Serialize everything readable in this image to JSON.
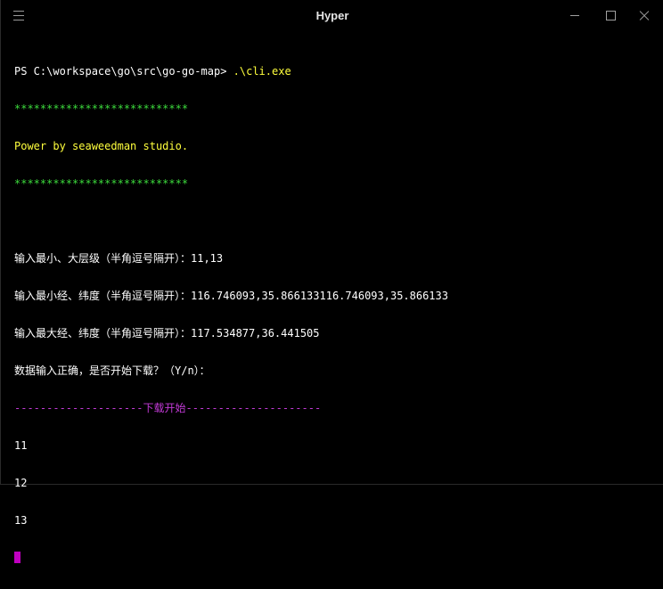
{
  "window": {
    "title": "Hyper",
    "menu_icon": "hamburger-menu-icon",
    "controls": {
      "minimize_icon": "minimize-icon",
      "maximize_icon": "maximize-icon",
      "close_icon": "close-icon"
    }
  },
  "terminal": {
    "prompt": "PS C:\\workspace\\go\\src\\go-go-map> ",
    "command": ".\\cli.exe",
    "stars_top": "***************************",
    "banner": "Power by seaweedman studio.",
    "stars_bottom": "***************************",
    "input_level": "输入最小、大层级（半角逗号隔开）：11,13",
    "input_min": "输入最小经、纬度（半角逗号隔开）：116.746093,35.866133116.746093,35.866133",
    "input_max": "输入最大经、纬度（半角逗号隔开）：117.534877,36.441505",
    "confirm": "数据输入正确，是否开始下载？（Y/n）：",
    "divider": "--------------------下载开始---------------------",
    "levels": [
      "11",
      "12",
      "13"
    ]
  },
  "colors": {
    "background": "#000000",
    "text": "#ffffff",
    "stars": "#3ddc3d",
    "banner": "#ffff3c",
    "divider": "#c23ad6",
    "cursor": "#c000c0"
  }
}
